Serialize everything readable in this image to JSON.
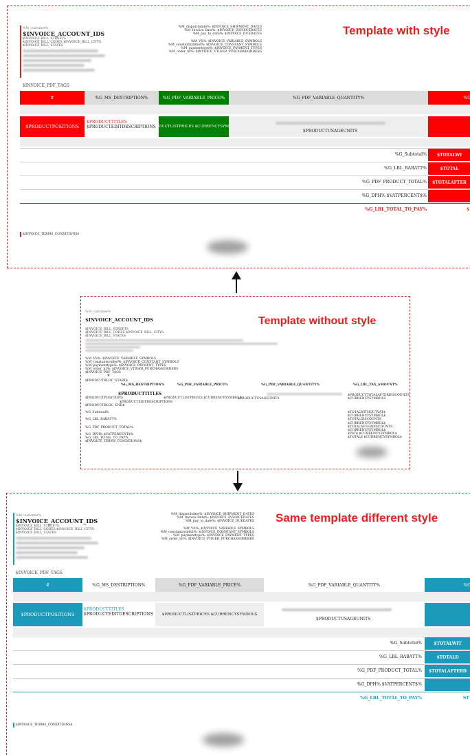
{
  "colors": {
    "red": "#ff0000",
    "green": "#008000",
    "teal": "#1a9bba",
    "gray_header": "#dcdcdc",
    "accent_title": "#e82020"
  },
  "top": {
    "title": "Template with style",
    "customer_label": "%M_customer%",
    "account_ids": "$INVOICE_ACCOUNT_IDS",
    "addr": [
      "$INVOICE_BILL_STREETS",
      "$INVOICE_BILL_CODES $INVOICE_BILL_CITYS",
      "$INVOICE_BILL_STATES"
    ],
    "right_info": [
      "%M_dispatchdate%: $INVOICE_SHIPMENT_DATES",
      "%M_Invoice Date%: $INVOICE_INVOICEDATES",
      "%M_pay_to_date%: $INVOICE_DUEDATES",
      "",
      "%M_VS%: $INVOICE_VARIABLE_SYMBOLS",
      "%M_constantsymbol%: $INVOICE_CONSTANT_SYMBOLS",
      "%M_paymenttype%: $INVOICE_PAYMENT_TYPES",
      "%M_order_nr%: $INVOICE_VTIGER_PURCHASEORDERS"
    ],
    "pdf_tags": "$INVOICE_PDF_TAGS",
    "headers": [
      "#",
      "%G_MS_DESTRIPTION%",
      "%G_PDF_VARIABLE_PRICE%",
      "%G_PDF_VARIABLE_QUANTITY%",
      "%G"
    ],
    "row": {
      "positions": "$PRODUCTPOSITIONS",
      "titles": "$PRODUCTTITLES",
      "desc": "$PRODUCTEDITDESCRIPTIONS",
      "prices": "$PRODUCTLISTPRICES $CURRENCYSYMBOLS",
      "units": "$PRODUCTUSAGEUNITS"
    },
    "summary": [
      {
        "label": "%G_Subtotal%",
        "value": "$TOTALWI"
      },
      {
        "label": "%G_LBL_RABATT%",
        "value": "$TOTAL"
      },
      {
        "label": "%G_PDF_PRODUCT_TOTAL%",
        "value": "$TOTALAFTER"
      },
      {
        "label": "%G_DPH% $VATPERCENT$%",
        "value": ""
      }
    ],
    "total_label": "%G_LBL_TOTAL_TO_PAY%",
    "total_value": "$",
    "terms": "$INVOICE_TERMS_CONDITIONS$"
  },
  "middle": {
    "title": "Template without style",
    "customer_label": "%M_customer%",
    "account_ids": "$INVOICE_ACCOUNT_IDS",
    "addr": [
      "$INVOICE_BILL_STREETS",
      "$INVOICE_BILL_CODES $INVOICE_BILL_CITYS",
      "$INVOICE_BILL_STATES"
    ],
    "info": [
      "%M_VS%: $INVOICE_VARIABLE_SYMBOLS",
      "%M_constantsymbol%: $INVOICE_CONSTANT_SYMBOLS",
      "%M_paymenttype%: $INVOICE_PAYMENT_TYPES",
      "%M_order_nr%: $INVOICE_VTIGER_PURCHASEORDERS",
      "$INVOICE_PDF_TAGS"
    ],
    "hash": "#",
    "headers": [
      "%G_MS_DESTRIPTION%",
      "%G_PDF_VARIABLE_PRICE%",
      "%G_PDF_VARIABLE_QUANTITY%",
      "%G_LBL_TAX_AMOUNT%"
    ],
    "bloc_start": "$PRODUCTBLOC_START$",
    "titles": "$PRODUCTTITLES",
    "positions": "$PRODUCTPOSITIONS",
    "prices": "$PRODUCTLISTPRICES $CURRENCYSYMBOLS",
    "units": "$PRODUCTUSAGEUNITS",
    "total_after": "$PRODUCTTOTALAFTERDISCOUNTS",
    "curr": "$CURRENCYSYMBOLS",
    "desc": "$PRODUCTEDITDESCRIPTIONS",
    "bloc_end": "$PRODUCTBLOC_END$",
    "subtotal": "%G_Subtotal%",
    "rabatt": "%G_LBL_RABATT%",
    "product_total": "%G_PDF_PRODUCT_TOTAL%",
    "dph": "%G_DPH% $VATPERCENT$%",
    "total_to_pay": "%G_LBL_TOTAL_TO_PAY%",
    "terms": "$INVOICE_TERMS_CONDITIONS$",
    "right_totals": [
      "$TOTALWITHOUTVAT$",
      "$CURRENCYSYMBOL$",
      "$TOTALDISCOUNTS",
      "$CURRENCYSYMBOL$",
      "$TOTALAFTERDISCOUNTS",
      "$CURRENCYSYMBOL$",
      "$VAT$ $CURRENCYSYMBOL$",
      "$TOTALS $CURRENCYSYMBOL$"
    ]
  },
  "bottom": {
    "title": "Same template different style",
    "customer_label": "%M_customer%",
    "account_ids": "$INVOICE_ACCOUNT_IDS",
    "addr": [
      "$INVOICE_BILL_STREETS",
      "$INVOICE_BILL_CODES $INVOICE_BILL_CITYS",
      "$INVOICE_BILL_STATES"
    ],
    "right_info": [
      "%M_dispatchdate%: $INVOICE_SHIPMENT_DATES",
      "%M_Invoice Date%: $INVOICE_INVOICEDATES",
      "%M_pay_to_date%: $INVOICE_DUEDATES",
      "",
      "%M_VS%: $INVOICE_VARIABLE_SYMBOLS",
      "%M_constantsymbol%: $INVOICE_CONSTANT_SYMBOLS",
      "%M_paymenttype%: $INVOICE_PAYMENT_TYPES",
      "%M_order_nr%: $INVOICE_VTIGER_PURCHASEORDERS"
    ],
    "pdf_tags": "$INVOICE_PDF_TAGS",
    "headers": [
      "#",
      "%G_MS_DESTRIPTION%",
      "%G_PDF_VARIABLE_PRICE%",
      "%G_PDF_VARIABLE_QUANTITY%",
      "%G"
    ],
    "row": {
      "positions": "$PRODUCTPOSITIONS",
      "titles": "$PRODUCTTITLES",
      "desc": "$PRODUCTEDITDESCRIPTIONS",
      "prices": "$PRODUCTLISTPRICES $CURRENCYSYMBOLS",
      "units": "$PRODUCTUSAGEUNITS"
    },
    "summary": [
      {
        "label": "%G_Subtotal%",
        "value": "$TOTALWIT"
      },
      {
        "label": "%G_LBL_RABATT%",
        "value": "$TOTALD"
      },
      {
        "label": "%G_PDF_PRODUCT_TOTAL%",
        "value": "$TOTALAFTERD"
      },
      {
        "label": "%G_DPH% $VATPERCENT$%",
        "value": ""
      }
    ],
    "total_label": "%G_LBL_TOTAL_TO_PAY%",
    "total_value": "ST",
    "terms": "$INVOICE_TERMS_CONDITIONS$"
  }
}
